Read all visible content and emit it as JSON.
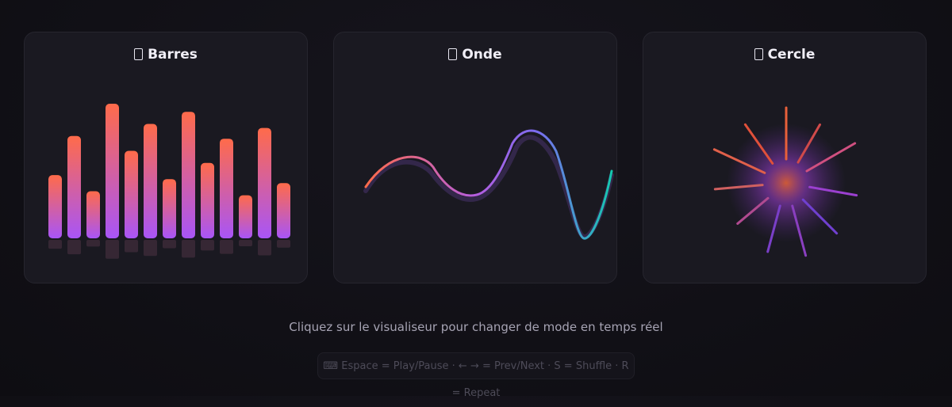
{
  "cards": [
    {
      "title": "Barres"
    },
    {
      "title": "Onde"
    },
    {
      "title": "Cercle"
    }
  ],
  "caption": "Cliquez sur le visualiseur pour changer de mode en temps réel",
  "shortcuts_hint": "⌨ Espace = Play/Pause · ← → = Prev/Next · S = Shuffle · R = Repeat",
  "colors": {
    "accent_start": "#ff6b4a",
    "accent_mid": "#a855f7",
    "accent_end": "#14c8b0",
    "card_bg": "#1a1921"
  },
  "bars_levels": [
    0.47,
    0.76,
    0.35,
    1.0,
    0.65,
    0.85,
    0.44,
    0.94,
    0.56,
    0.74,
    0.32,
    0.82,
    0.41
  ]
}
